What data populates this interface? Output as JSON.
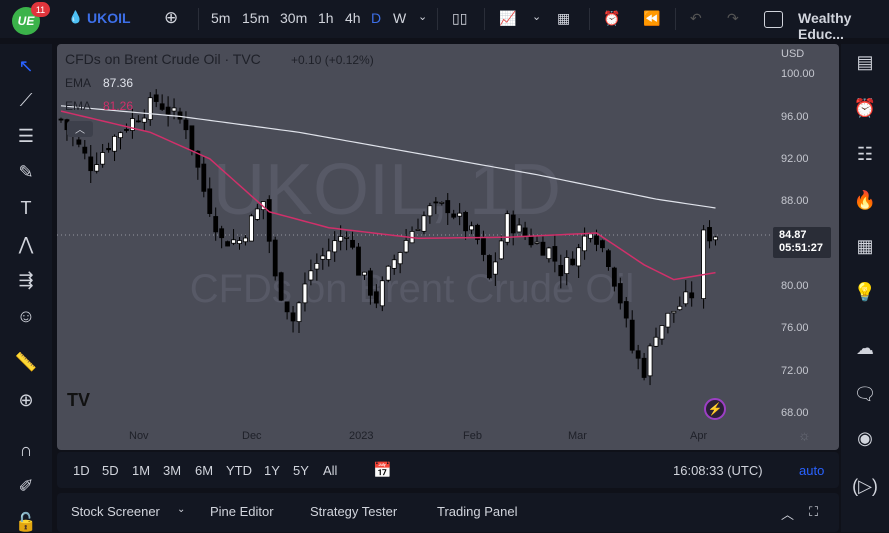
{
  "header": {
    "notification_count": "11",
    "symbol": "UKOIL",
    "intervals": [
      "5m",
      "15m",
      "30m",
      "1h",
      "4h",
      "D",
      "W"
    ],
    "active_interval": "D",
    "account": "Wealthy Educ..."
  },
  "legend": {
    "title": "CFDs on Brent Crude Oil · TVC",
    "change": "+0.10 (+0.12%)",
    "ema1_label": "EMA",
    "ema1_value": "87.36",
    "ema2_label": "EMA",
    "ema2_value": "81.26"
  },
  "watermark": {
    "symbol": "UKOIL, 1D",
    "name": "CFDs on Brent Crude Oil"
  },
  "price_axis": {
    "currency": "USD",
    "ticks": [
      "100.00",
      "96.00",
      "92.00",
      "88.00",
      "80.00",
      "76.00",
      "72.00",
      "68.00"
    ],
    "last_price": "84.87",
    "countdown": "05:51:27"
  },
  "time_axis": {
    "ticks": [
      "Nov",
      "Dec",
      "2023",
      "Feb",
      "Mar",
      "Apr"
    ]
  },
  "colors": {
    "ema1": "#e0e3eb",
    "ema2": "#d0306a",
    "accent": "#2962ff",
    "bg": "#4a4c57"
  },
  "chart_data": {
    "type": "candlestick",
    "ylim": [
      66,
      102
    ],
    "price_path": [
      [
        0,
        95.7
      ],
      [
        5,
        91.4
      ],
      [
        10,
        94.7
      ],
      [
        16,
        97.5
      ],
      [
        21,
        95.2
      ],
      [
        24,
        89
      ],
      [
        27,
        84.3
      ],
      [
        30,
        84.3
      ],
      [
        34,
        88
      ],
      [
        36,
        80.6
      ],
      [
        39,
        76.8
      ],
      [
        42,
        81.5
      ],
      [
        45,
        83.4
      ],
      [
        48,
        85.3
      ],
      [
        50,
        81.5
      ],
      [
        53,
        78.7
      ],
      [
        56,
        82.5
      ],
      [
        59,
        85.3
      ],
      [
        62,
        87.2
      ],
      [
        65,
        87.5
      ],
      [
        67,
        86.2
      ],
      [
        70,
        84.3
      ],
      [
        72,
        80.6
      ],
      [
        75,
        86.2
      ],
      [
        79,
        84.3
      ],
      [
        82,
        83.4
      ],
      [
        84,
        81.5
      ],
      [
        87,
        83.4
      ],
      [
        89,
        85.7
      ],
      [
        92,
        82.5
      ],
      [
        94,
        78.7
      ],
      [
        96,
        74
      ],
      [
        98,
        72
      ],
      [
        100,
        75.8
      ],
      [
        103,
        77.7
      ],
      [
        106,
        79.2
      ],
      [
        108,
        84.7
      ],
      [
        110,
        84.87
      ]
    ],
    "ema_long": [
      [
        0,
        97
      ],
      [
        20,
        96
      ],
      [
        40,
        94.5
      ],
      [
        60,
        92.5
      ],
      [
        80,
        90.5
      ],
      [
        100,
        88.2
      ],
      [
        110,
        87.36
      ]
    ],
    "ema_short": [
      [
        0,
        96.5
      ],
      [
        15,
        94.5
      ],
      [
        25,
        92
      ],
      [
        35,
        87
      ],
      [
        45,
        85.5
      ],
      [
        60,
        84.5
      ],
      [
        75,
        84.6
      ],
      [
        90,
        85
      ],
      [
        98,
        82
      ],
      [
        103,
        80.6
      ],
      [
        110,
        81.26
      ]
    ]
  },
  "range_buttons": [
    "1D",
    "5D",
    "1M",
    "3M",
    "6M",
    "YTD",
    "1Y",
    "5Y",
    "All"
  ],
  "clock": "16:08:33 (UTC)",
  "scale_mode": "auto",
  "panel_tabs": [
    "Stock Screener",
    "Pine Editor",
    "Strategy Tester",
    "Trading Panel"
  ]
}
